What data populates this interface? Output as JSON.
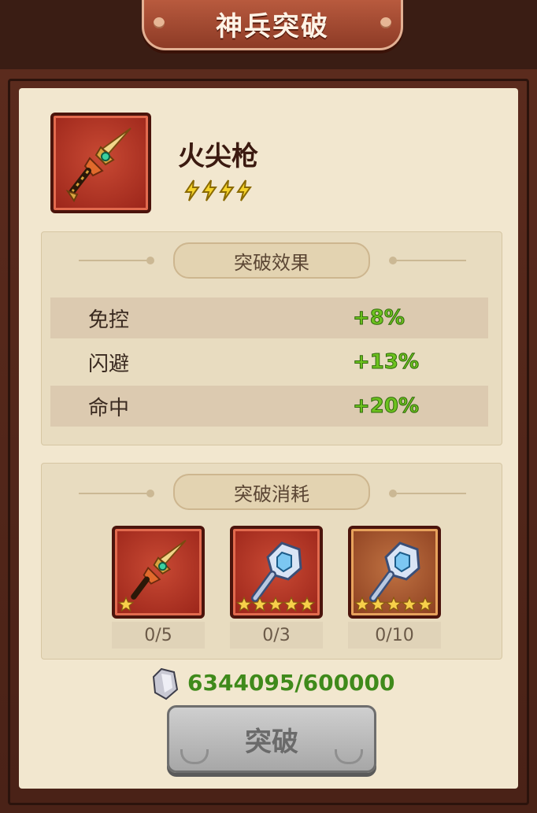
{
  "header": {
    "title": "神兵突破"
  },
  "item": {
    "name": "火尖枪",
    "level_icons": 4,
    "icon": "spear-icon"
  },
  "effects": {
    "title": "突破效果",
    "stats": [
      {
        "name": "免控",
        "value": "+8%"
      },
      {
        "name": "闪避",
        "value": "+13%"
      },
      {
        "name": "命中",
        "value": "+20%"
      }
    ]
  },
  "cost": {
    "title": "突破消耗",
    "materials": [
      {
        "icon": "spear-icon",
        "stars": 1,
        "frame": "red",
        "count": "0/5"
      },
      {
        "icon": "crystal-staff-icon",
        "stars": 5,
        "frame": "red",
        "count": "0/3"
      },
      {
        "icon": "crystal-staff-icon",
        "stars": 5,
        "frame": "orange",
        "count": "0/10"
      }
    ],
    "currency": "6344095/600000",
    "currency_icon": "gem-icon"
  },
  "action": {
    "button_label": "突破"
  },
  "colors": {
    "stat_green": "#6dc21f",
    "currency_green": "#3f8a1b",
    "title_red": "#8d3b26"
  }
}
